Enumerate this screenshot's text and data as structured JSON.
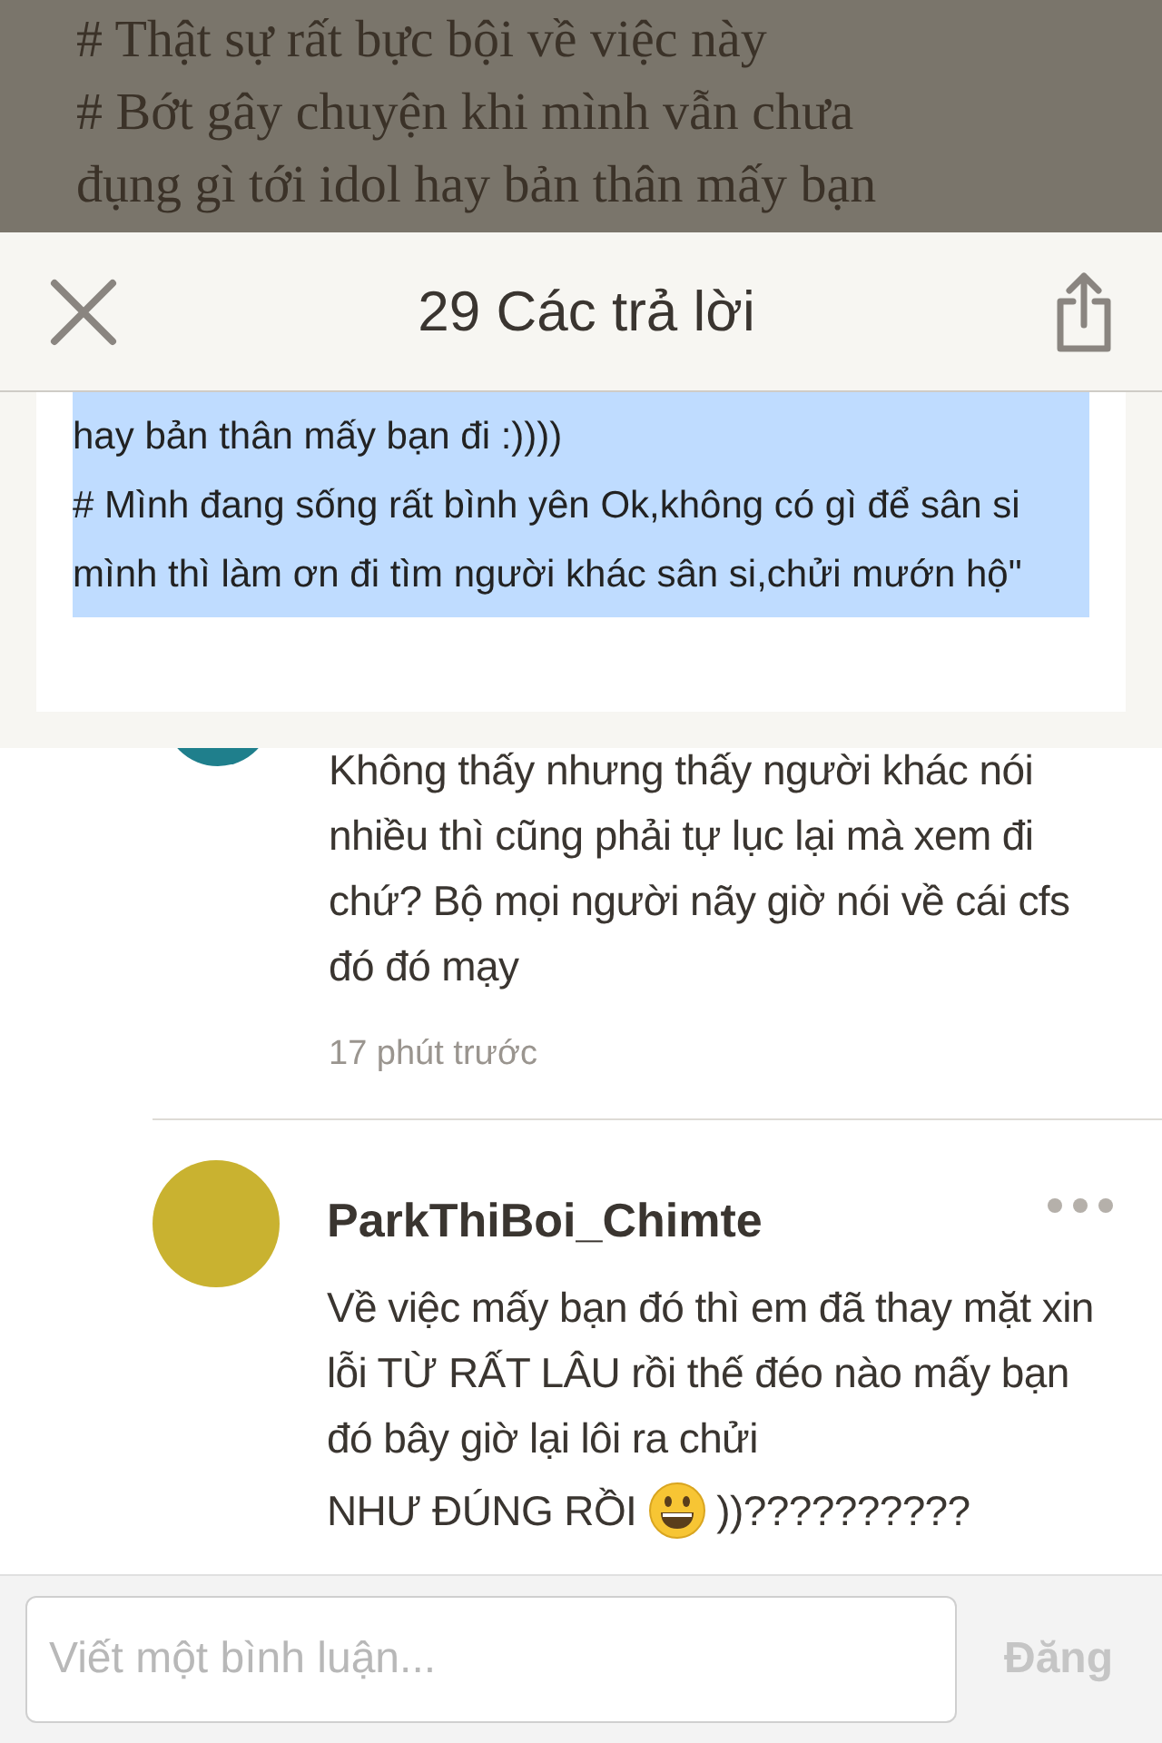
{
  "article_background": {
    "lines": [
      "# Thật sự rất bực bội về việc này",
      "# Bớt gây chuyện khi mình vẫn chưa",
      "đụng gì tới idol hay bản thân mấy bạn"
    ]
  },
  "header": {
    "title": "29 Các trả lời"
  },
  "quoted_post": {
    "lines": [
      "hay bản thân mấy bạn đi :))))",
      "# Mình đang sống rất bình yên Ok,không có gì để sân si mình thì làm ơn đi tìm người khác sân si,chửi mướn hộ\""
    ],
    "highlighted": true
  },
  "comments": [
    {
      "text": "Không thấy nhưng thấy người khác nói nhiều thì cũng phải tự lục lại mà xem đi chứ? Bộ mọi người nãy giờ nói về cái cfs đó đó mạy",
      "time": "17 phút trước"
    },
    {
      "author": "ParkThiBoi_Chimte",
      "text": "Về việc mấy bạn đó thì em đã thay mặt xin lỗi TỪ RẤT LÂU rồi thế đéo nào mấy bạn đó bây giờ lại lôi ra chửi",
      "emoji_line": {
        "before": "NHƯ ĐÚNG RỒI",
        "after": "))??????????"
      }
    }
  ],
  "composer": {
    "placeholder": "Viết một bình luận...",
    "submit": "Đăng",
    "submit_disabled": true
  }
}
